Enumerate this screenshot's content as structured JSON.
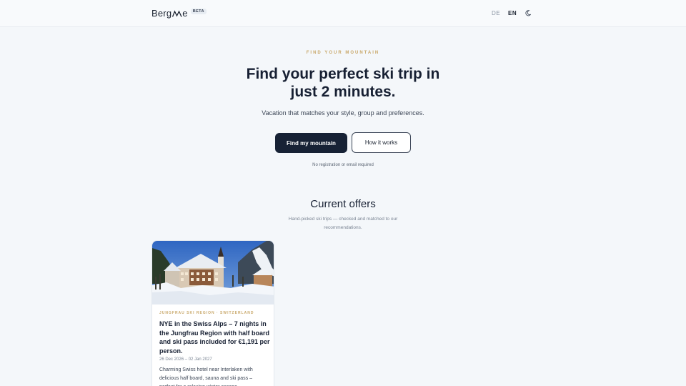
{
  "header": {
    "logo_text_left": "Berg",
    "logo_text_right": "e",
    "beta_label": "BETA",
    "lang_de": "DE",
    "lang_en": "EN",
    "theme_icon": "moon-icon"
  },
  "hero": {
    "eyebrow": "FIND YOUR MOUNTAIN",
    "title": "Find your perfect ski trip in just 2 minutes.",
    "subtitle": "Vacation that matches your style, group and preferences.",
    "primary_button": "Find my mountain",
    "secondary_button": "How it works",
    "note": "No registration or email required"
  },
  "offers": {
    "title": "Current offers",
    "subtitle": "Hand-picked ski trips — checked and matched to our recommendations.",
    "cards": [
      {
        "region": "JUNGFRAU SKI REGION · SWITZERLAND",
        "title": "NYE in the Swiss Alps – 7 nights in the Jungfrau Region with half board and ski pass included for €1,191 per person.",
        "dates": "26 Dec 2026 – 02 Jan 2027",
        "description": "Charming Swiss hotel near Interlaken with delicious half board, sauna and ski pass – perfect for a relaxing winter escape."
      }
    ]
  },
  "colors": {
    "background": "#f4f7fa",
    "primary": "#172235",
    "accent": "#c9a86a"
  }
}
